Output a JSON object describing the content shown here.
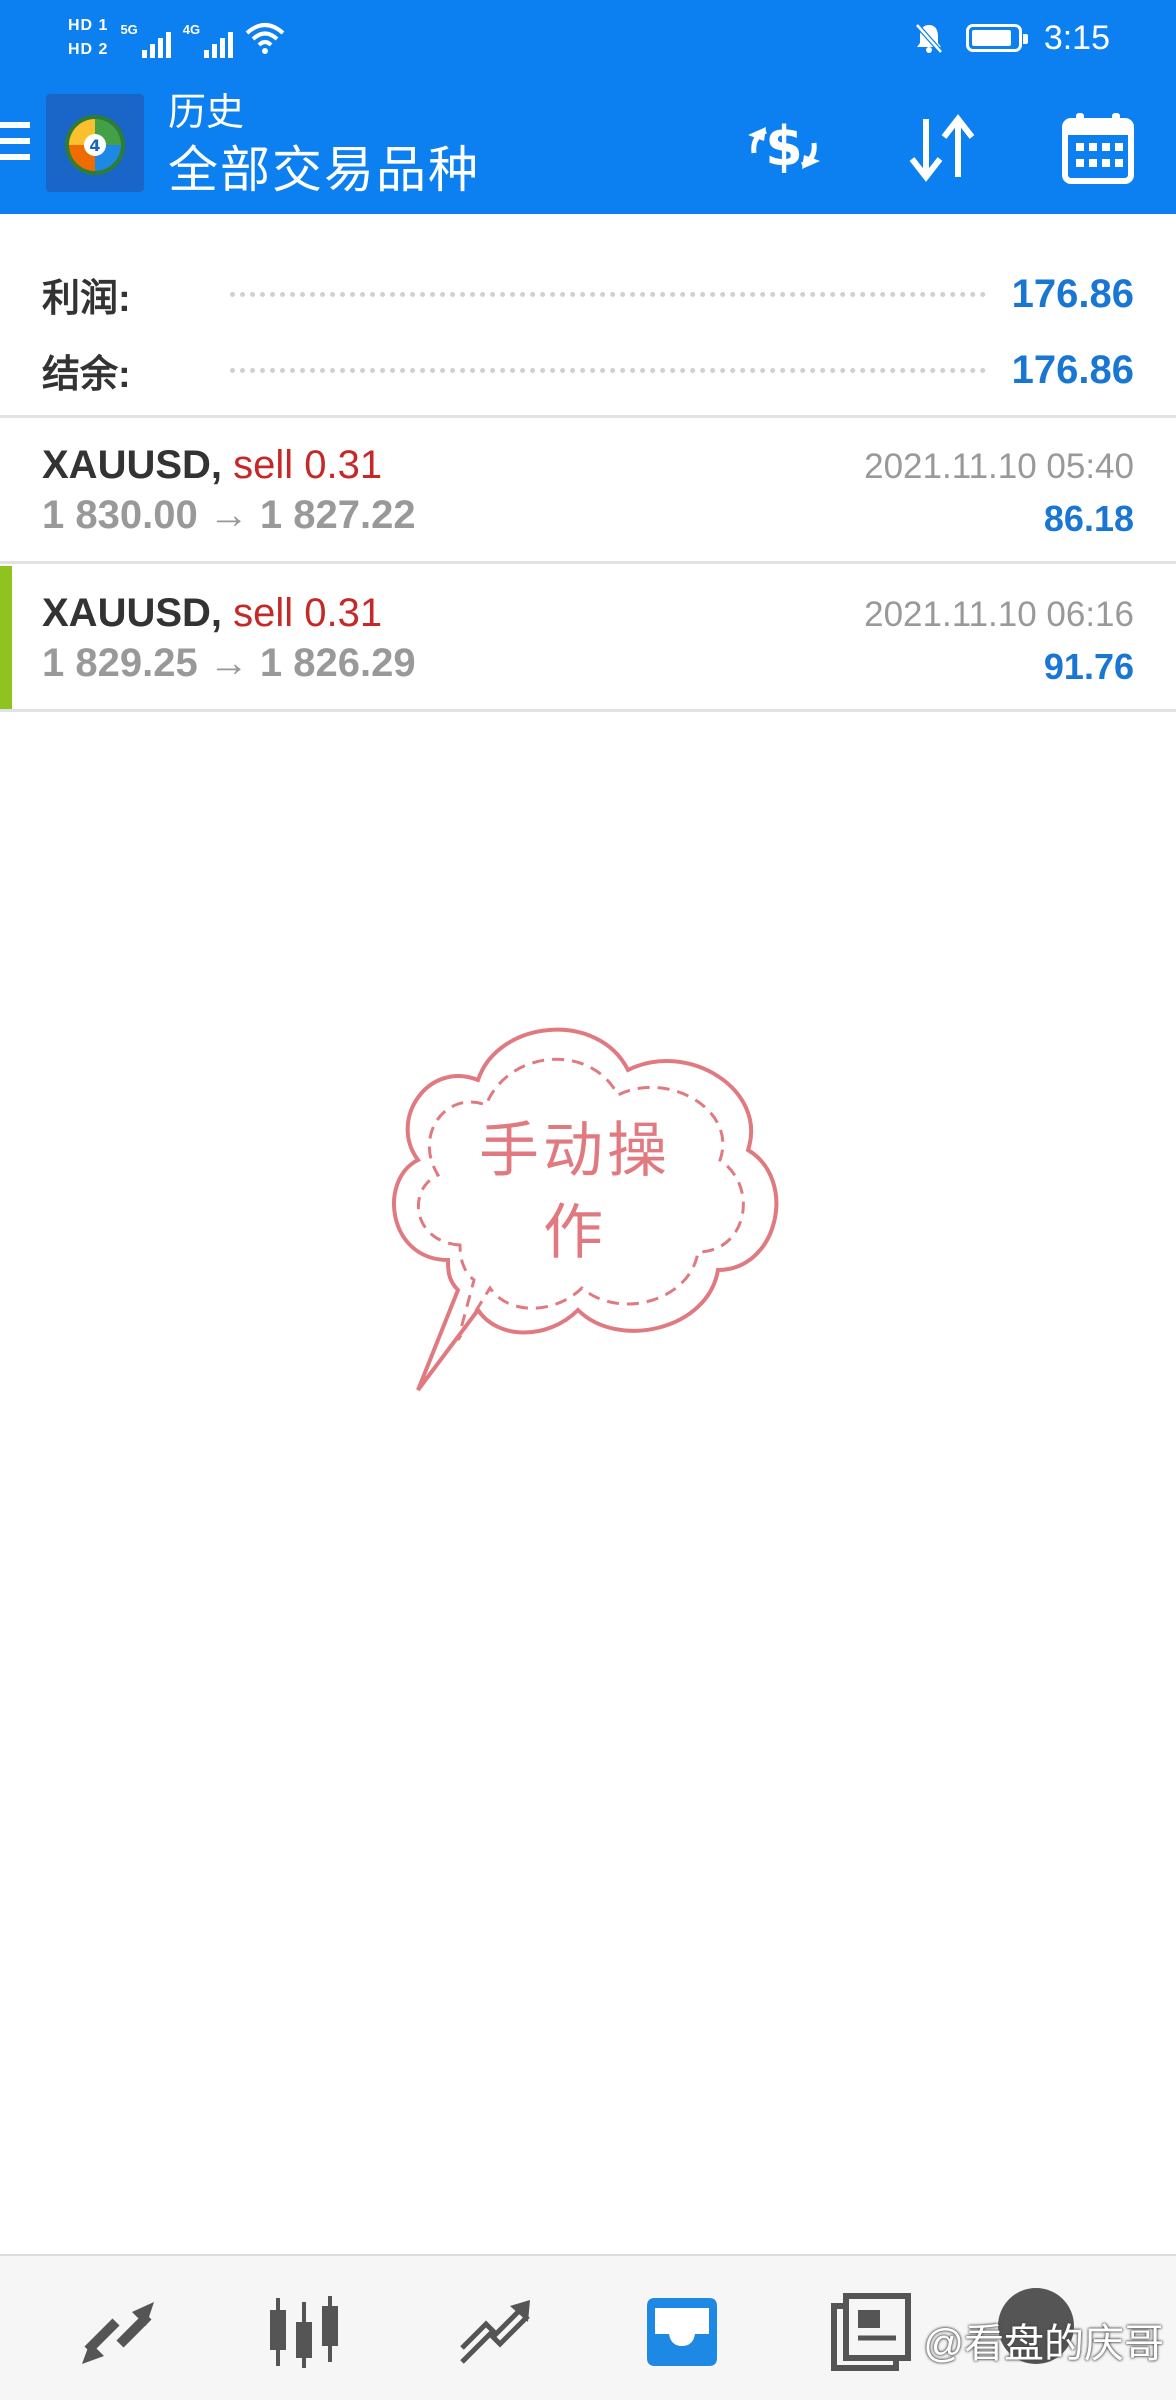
{
  "status_bar": {
    "sim1_label": "HD 1",
    "sim2_label": "HD 2",
    "net1": "5G",
    "net2": "4G",
    "time": "3:15",
    "battery_level": 0.9,
    "icons": [
      "signal-icon",
      "wifi-icon",
      "mute-bell-icon",
      "battery-icon"
    ]
  },
  "app_bar": {
    "title": "历史",
    "subtitle": "全部交易品种",
    "icons": [
      "menu-icon",
      "metatrader-logo",
      "currency-exchange-icon",
      "sort-icon",
      "calendar-icon"
    ]
  },
  "summary": {
    "profit_label": "利润:",
    "profit_value": "176.86",
    "balance_label": "结余:",
    "balance_value": "176.86"
  },
  "deals": [
    {
      "symbol": "XAUUSD,",
      "type": "sell 0.31",
      "prices": "1 830.00 → 1 827.22",
      "time": "2021.11.10 05:40",
      "profit": "86.18"
    },
    {
      "symbol": "XAUUSD,",
      "type": "sell 0.31",
      "prices": "1 829.25 → 1 826.29",
      "time": "2021.11.10 06:16",
      "profit": "91.76"
    }
  ],
  "stamp": {
    "text": "手动操作"
  },
  "bottom_nav": {
    "items": [
      "quotes-icon",
      "chart-icon",
      "trade-icon",
      "history-icon",
      "messages-icon"
    ],
    "active": "history-icon",
    "watermark": "@看盘的庆哥"
  },
  "colors": {
    "primary": "#0c80f0",
    "value_blue": "#1976d2",
    "sell_red": "#c62828",
    "marker_green": "#8fc31f",
    "stamp_pink": "#e07a80"
  }
}
